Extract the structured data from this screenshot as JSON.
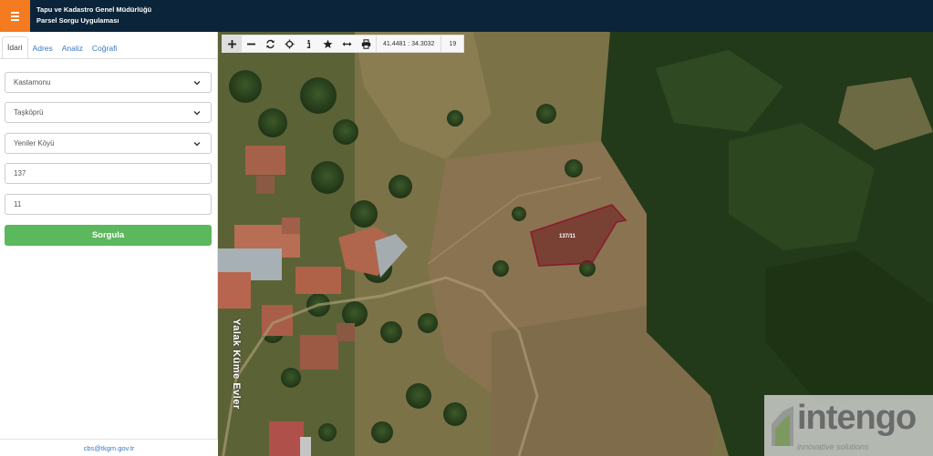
{
  "header": {
    "title_line1": "Tapu ve Kadastro Genel Müdürlüğü",
    "title_line2": "Parsel Sorgu Uygulaması",
    "menu_icon": "hamburger-icon",
    "accent_color": "#f47b20",
    "bar_color": "#0b2439"
  },
  "sidebar": {
    "tabs": [
      {
        "label": "İdari",
        "active": true
      },
      {
        "label": "Adres",
        "active": false
      },
      {
        "label": "Analiz",
        "active": false
      },
      {
        "label": "Coğrafi",
        "active": false
      }
    ],
    "province": "Kastamonu",
    "district": "Taşköprü",
    "neighborhood": "Yeniler Köyü",
    "block": "137",
    "parcel": "11",
    "query_button": "Sorgula",
    "query_button_color": "#5cb85c",
    "footer_email": "cbs@tkgm.gov.tr"
  },
  "map": {
    "toolbar": {
      "tools": [
        "zoom-in-icon",
        "zoom-out-icon",
        "refresh-icon",
        "locate-icon",
        "info-icon",
        "favorite-icon",
        "measure-icon",
        "print-icon"
      ],
      "coordinates": "41.4481 : 34.3032",
      "zoom_level": "19"
    },
    "parcel_label": "137/11",
    "parcel_color": "#8b1a2b",
    "road_label": "Yalak Küme Evler",
    "watermark": {
      "brand": "intengo",
      "tagline": "innovative solutions"
    }
  }
}
